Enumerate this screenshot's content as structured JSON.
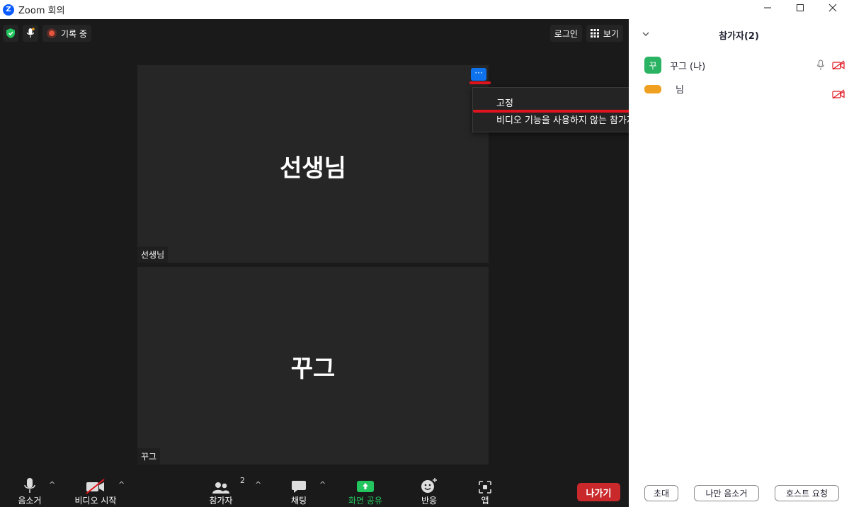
{
  "window": {
    "logo_letter": "Z",
    "title": "Zoom 회의"
  },
  "top_left": {
    "recording_label": "기록 중"
  },
  "top_right": {
    "login_label": "로그인",
    "view_label": "보기"
  },
  "tiles": [
    {
      "name": "선생님",
      "label": "선생님"
    },
    {
      "name": "꾸그",
      "label": "꾸그"
    }
  ],
  "more_button": {
    "label": "···"
  },
  "context_menu": {
    "items": [
      "고정",
      "비디오 기능을 사용하지 않는 참가자 숨기기"
    ]
  },
  "toolbar": {
    "mute_label": "음소거",
    "video_label": "비디오 시작",
    "participants_label": "참가자",
    "participants_count": "2",
    "chat_label": "채팅",
    "share_label": "화면 공유",
    "reactions_label": "반응",
    "apps_label": "앱",
    "leave_label": "나가기"
  },
  "panel": {
    "title": "참가자(2)",
    "participants": [
      {
        "initial": "꾸",
        "name": "꾸그 (나)",
        "avatar_color": "#2ab362"
      },
      {
        "initial": "",
        "name": "님",
        "avatar_color": "#f0a020"
      }
    ],
    "invite_label": "초대",
    "mute_me_label": "나만 음소거",
    "ask_host_label": "호스트 요청"
  },
  "colors": {
    "accent": "#0e72ed",
    "share_green": "#22c55e",
    "leave_red": "#c9292a",
    "highlight_red": "#e0141e"
  }
}
